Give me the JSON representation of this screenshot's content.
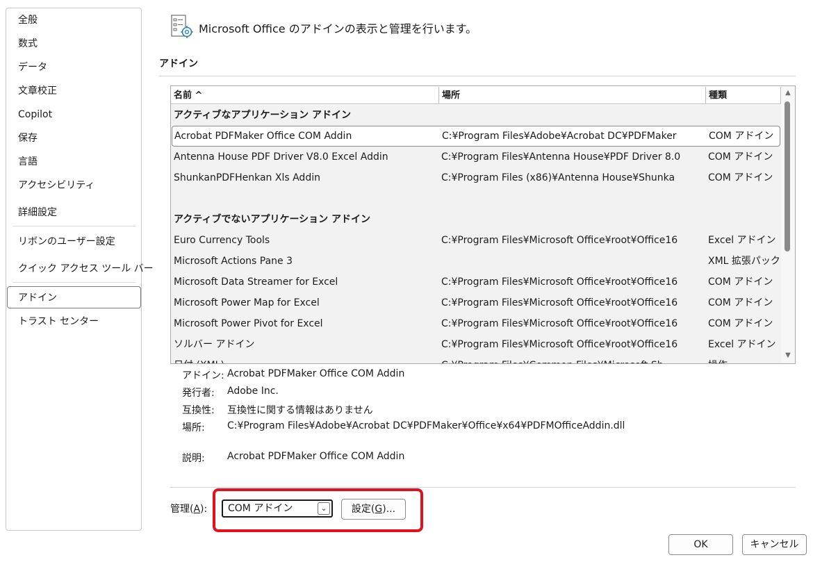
{
  "sidebar": {
    "items": [
      {
        "label": "全般"
      },
      {
        "label": "数式"
      },
      {
        "label": "データ"
      },
      {
        "label": "文章校正"
      },
      {
        "label": "Copilot"
      },
      {
        "label": "保存"
      },
      {
        "label": "言語"
      },
      {
        "label": "アクセシビリティ"
      },
      {
        "label": "詳細設定"
      },
      {
        "label": "リボンのユーザー設定"
      },
      {
        "label": "クイック アクセス ツール バー"
      },
      {
        "label": "アドイン",
        "selected": true
      },
      {
        "label": "トラスト センター"
      }
    ]
  },
  "header": {
    "title": "Microsoft Office のアドインの表示と管理を行います。",
    "icon": "addin-settings-icon"
  },
  "section_title": "アドイン",
  "list": {
    "columns": {
      "name": "名前 ^",
      "location": "場所",
      "type": "種類"
    },
    "active_group": "アクティブなアプリケーション アドイン",
    "active_rows": [
      {
        "name": "Acrobat PDFMaker Office COM Addin",
        "location": "C:¥Program Files¥Adobe¥Acrobat DC¥PDFMaker",
        "type": "COM アドイン"
      },
      {
        "name": "Antenna House PDF Driver V8.0 Excel Addin",
        "location": "C:¥Program Files¥Antenna House¥PDF Driver 8.0",
        "type": "COM アドイン"
      },
      {
        "name": "ShunkanPDFHenkan Xls Addin",
        "location": "C:¥Program Files (x86)¥Antenna House¥Shunka",
        "type": "COM アドイン"
      }
    ],
    "inactive_group": "アクティブでないアプリケーション アドイン",
    "inactive_rows": [
      {
        "name": "Euro Currency Tools",
        "location": "C:¥Program Files¥Microsoft Office¥root¥Office16",
        "type": "Excel アドイン"
      },
      {
        "name": "Microsoft Actions Pane 3",
        "location": "",
        "type": "XML 拡張パック"
      },
      {
        "name": "Microsoft Data Streamer for Excel",
        "location": "C:¥Program Files¥Microsoft Office¥root¥Office16",
        "type": "COM アドイン"
      },
      {
        "name": "Microsoft Power Map for Excel",
        "location": "C:¥Program Files¥Microsoft Office¥root¥Office16",
        "type": "COM アドイン"
      },
      {
        "name": "Microsoft Power Pivot for Excel",
        "location": "C:¥Program Files¥Microsoft Office¥root¥Office16",
        "type": "COM アドイン"
      },
      {
        "name": "ソルバー アドイン",
        "location": "C:¥Program Files¥Microsoft Office¥root¥Office16",
        "type": "Excel アドイン"
      },
      {
        "name": "日付 (XML)",
        "location": "C:¥Program Files¥Common Files¥Microsoft Sh",
        "type": "操作"
      }
    ]
  },
  "details": {
    "addin_label": "アドイン:",
    "addin_value": "Acrobat PDFMaker Office COM Addin",
    "publisher_label": "発行者:",
    "publisher_value": "Adobe Inc.",
    "compat_label": "互換性:",
    "compat_value": "互換性に関する情報はありません",
    "location_label": "場所:",
    "location_value": "C:¥Program Files¥Adobe¥Acrobat DC¥PDFMaker¥Office¥x64¥PDFMOfficeAddin.dll",
    "description_label": "説明:",
    "description_value": "Acrobat PDFMaker Office COM Addin"
  },
  "manage": {
    "label_prefix": "管理(",
    "label_key": "A",
    "label_suffix": "):",
    "selected": "COM アドイン",
    "go_prefix": "設定(",
    "go_key": "G",
    "go_suffix": ")..."
  },
  "buttons": {
    "ok": "OK",
    "cancel": "キャンセル"
  },
  "colors": {
    "highlight": "#e3101e",
    "list_background": "#f2f2f2"
  }
}
